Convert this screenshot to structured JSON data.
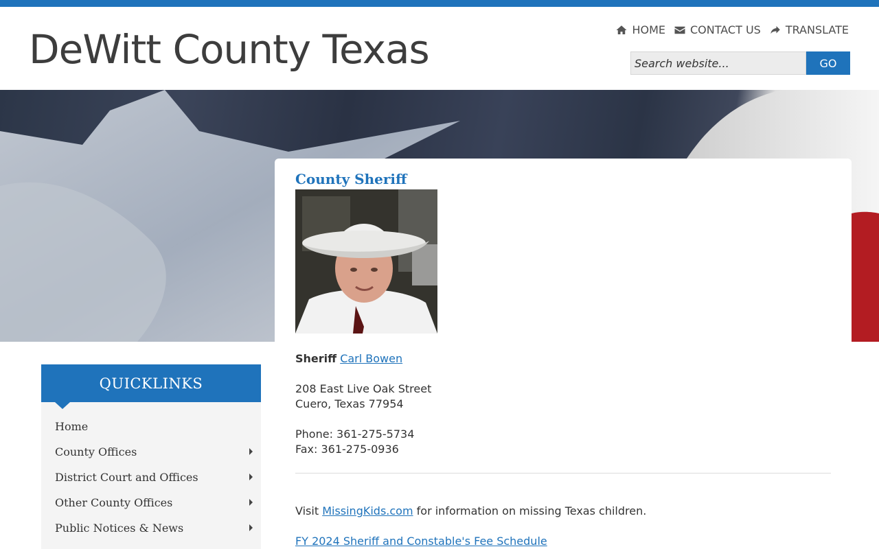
{
  "header": {
    "site_title": "DeWitt County Texas",
    "nav": [
      {
        "label": "HOME",
        "icon": "home-icon"
      },
      {
        "label": "CONTACT US",
        "icon": "envelope-icon"
      },
      {
        "label": "TRANSLATE",
        "icon": "share-arrow-icon"
      }
    ],
    "search_placeholder": "Search website...",
    "search_button": "GO"
  },
  "content": {
    "title": "County Sheriff",
    "sheriff_prefix": "Sheriff",
    "sheriff_name": "Carl Bowen",
    "address_line1": "208 East Live Oak Street",
    "address_line2": "Cuero, Texas 77954",
    "phone": "Phone: 361-275-5734",
    "fax": "Fax: 361-275-0936",
    "visit_prefix": "Visit",
    "visit_link": "MissingKids.com",
    "visit_suffix": "for information on missing Texas children.",
    "fee_schedule_link": "FY 2024 Sheriff and Constable's Fee Schedule"
  },
  "quicklinks": {
    "title": "QUICKLINKS",
    "items": [
      {
        "label": "Home"
      },
      {
        "label": "County Offices"
      },
      {
        "label": "District Court and Offices"
      },
      {
        "label": "Other County Offices"
      },
      {
        "label": "Public Notices & News"
      }
    ]
  },
  "colors": {
    "accent": "#1f73bb",
    "text": "#333333",
    "title": "#3d3d3d"
  }
}
